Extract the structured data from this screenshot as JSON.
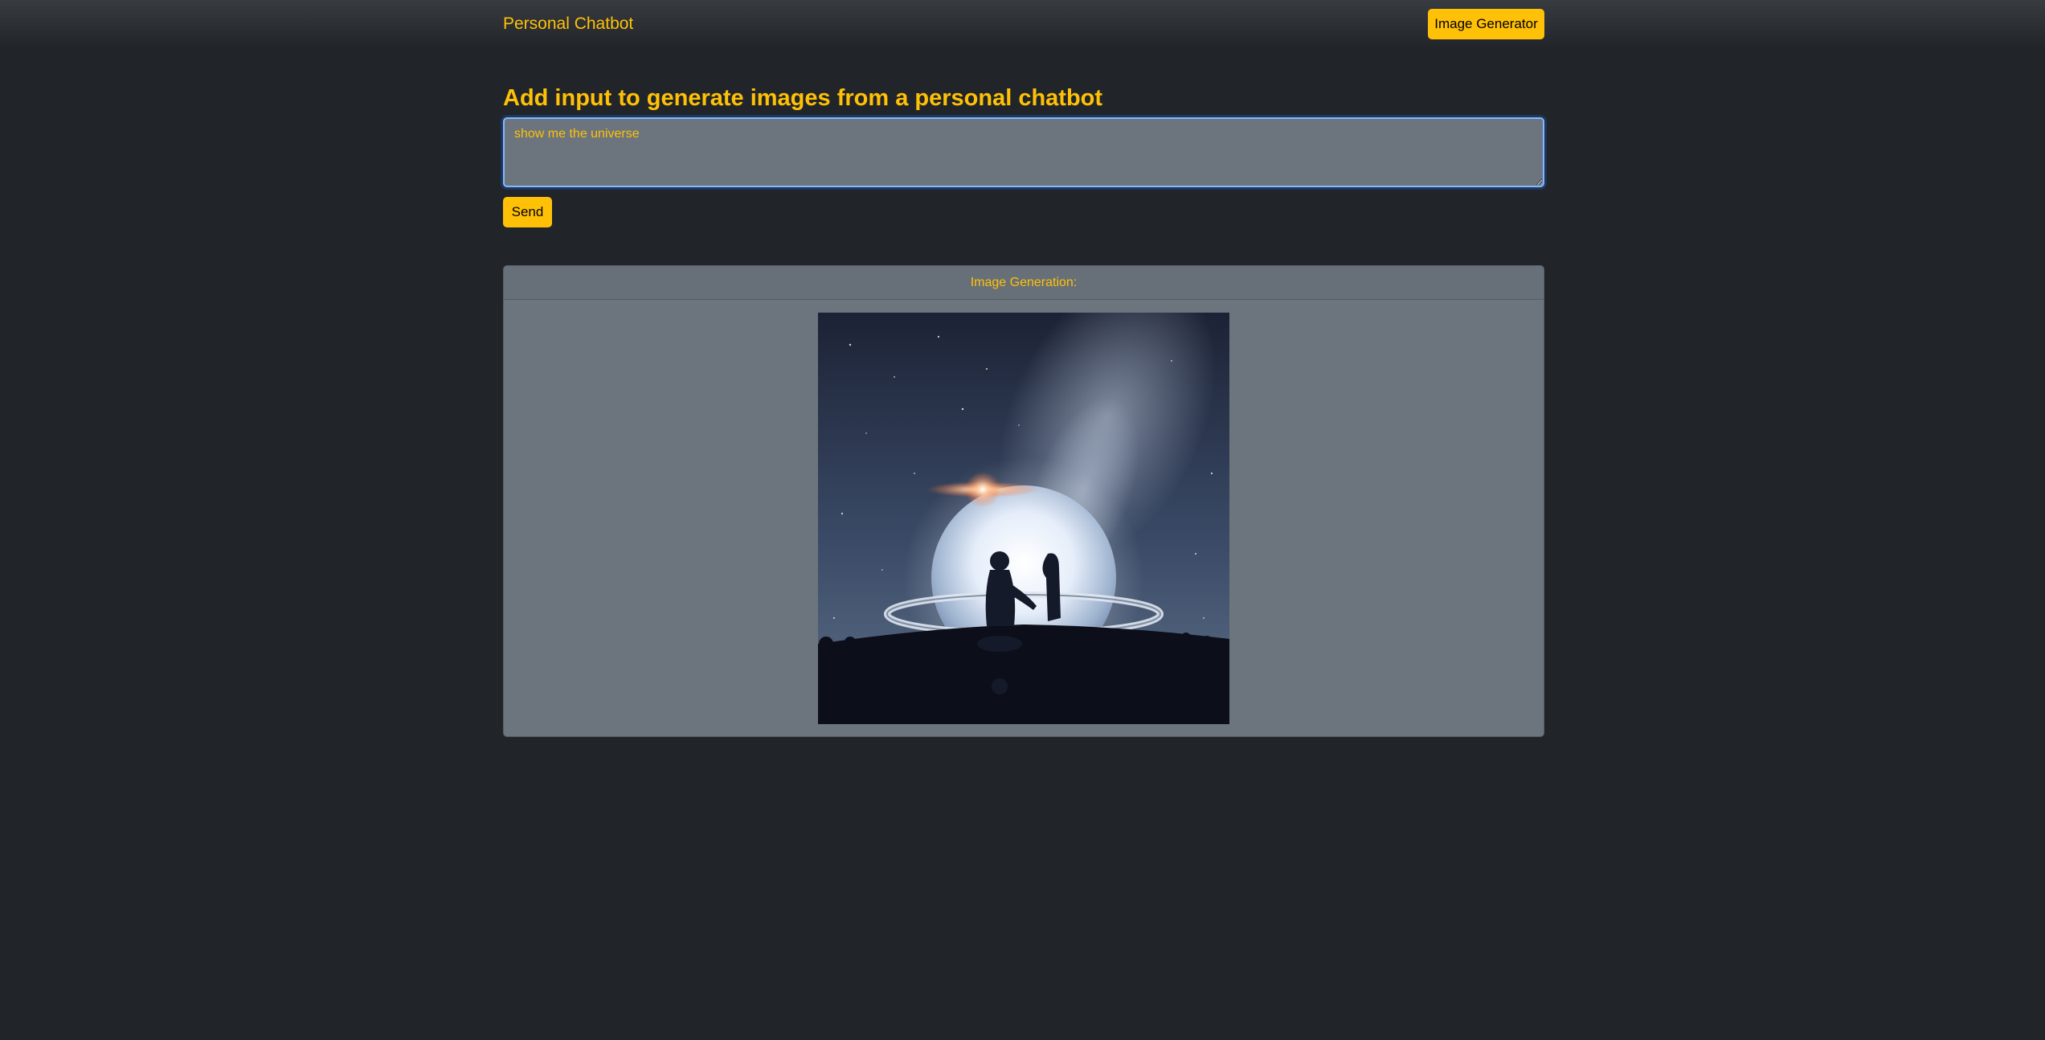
{
  "navbar": {
    "brand": "Personal Chatbot",
    "image_generator_button": "Image Generator"
  },
  "main": {
    "heading": "Add input to generate images from a personal chatbot",
    "prompt_value": "show me the universe",
    "send_button": "Send"
  },
  "result": {
    "header": "Image Generation:",
    "image_description": "Silhouettes of two figures inside a glowing sphere ringed like a planet, beneath a starry sky with a nebula and a bright sun flare"
  },
  "colors": {
    "background": "#212529",
    "accent": "#ffc107",
    "panel": "#6c757d",
    "focus_ring": "#86b7fe"
  }
}
